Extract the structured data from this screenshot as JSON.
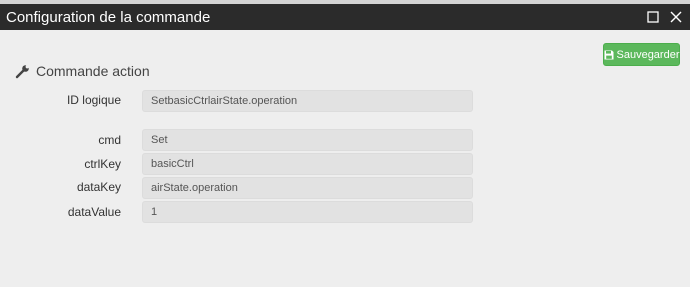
{
  "window": {
    "title": "Configuration de la commande",
    "maximize_icon": "maximize-icon",
    "close_icon": "close-icon"
  },
  "toolbar": {
    "save_label": "Sauvegarder",
    "save_icon": "floppy-disk-icon",
    "save_color": "#5cb85c"
  },
  "section": {
    "title": "Commande action",
    "icon": "wrench-icon"
  },
  "fields": {
    "logical_id": {
      "label": "ID logique",
      "value": "SetbasicCtrlairState.operation"
    },
    "cmd": {
      "label": "cmd",
      "value": "Set"
    },
    "ctrl_key": {
      "label": "ctrlKey",
      "value": "basicCtrl"
    },
    "data_key": {
      "label": "dataKey",
      "value": "airState.operation"
    },
    "data_value": {
      "label": "dataValue",
      "value": "1"
    }
  }
}
